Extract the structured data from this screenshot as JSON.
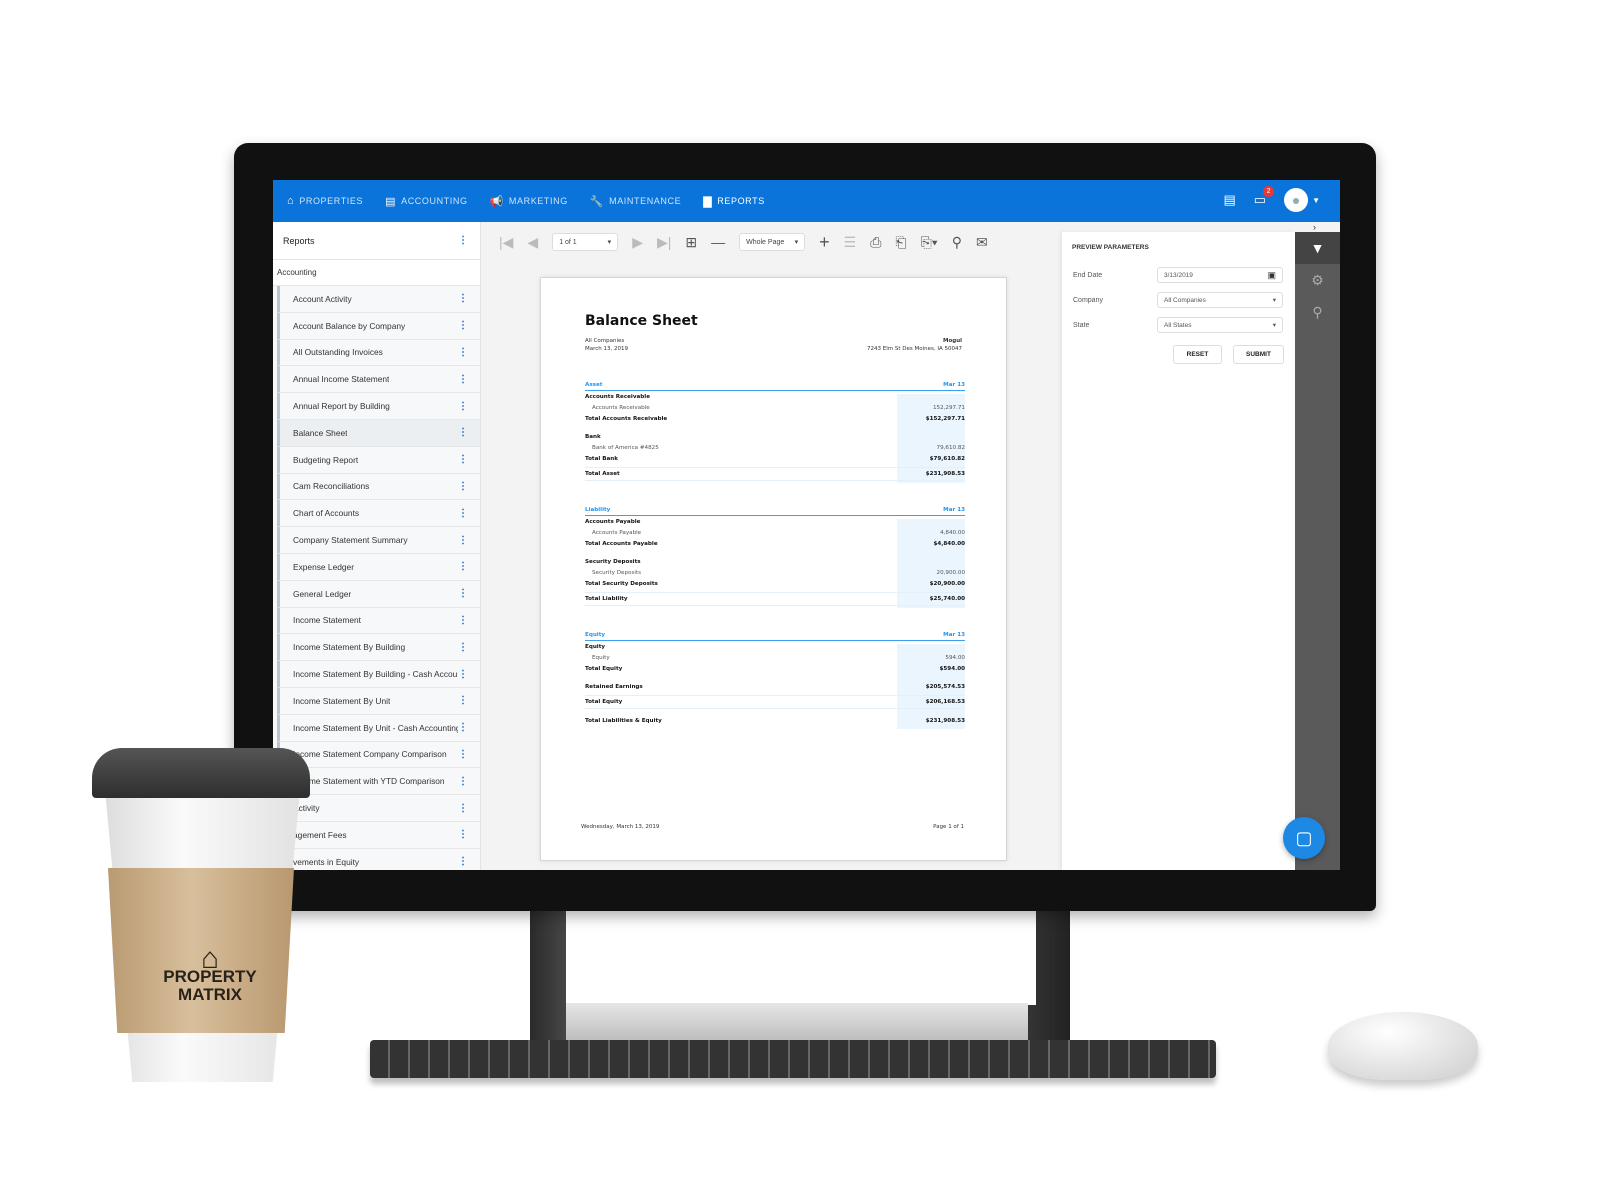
{
  "nav": {
    "items": [
      {
        "icon": "home-icon",
        "glyph": "⌂",
        "label": "PROPERTIES"
      },
      {
        "icon": "clipboard-icon",
        "glyph": "▤",
        "label": "ACCOUNTING"
      },
      {
        "icon": "megaphone-icon",
        "glyph": "📢",
        "label": "MARKETING"
      },
      {
        "icon": "wrench-icon",
        "glyph": "🔧",
        "label": "MAINTENANCE"
      },
      {
        "icon": "document-icon",
        "glyph": "▇",
        "label": "REPORTS"
      }
    ],
    "active": 4,
    "notification_count": "2"
  },
  "sidebar": {
    "title": "Reports",
    "section": "Accounting",
    "selected": 5,
    "items": [
      "Account Activity",
      "Account Balance by Company",
      "All Outstanding Invoices",
      "Annual Income Statement",
      "Annual Report by Building",
      "Balance Sheet",
      "Budgeting Report",
      "Cam Reconciliations",
      "Chart of Accounts",
      "Company Statement Summary",
      "Expense Ledger",
      "General Ledger",
      "Income Statement",
      "Income Statement By Building",
      "Income Statement By Building - Cash Accou...",
      "Income Statement By Unit",
      "Income Statement By Unit - Cash Accounting",
      "Income Statement Company Comparison",
      "Income Statement with YTD Comparison",
      "Activity",
      "agement Fees",
      "vements in Equity"
    ]
  },
  "toolbar": {
    "page_select": "1 of 1",
    "zoom_select": "Whole Page"
  },
  "report": {
    "title": "Balance Sheet",
    "company_filter": "All Companies",
    "date": "March 13, 2019",
    "company_name": "Mogul",
    "address": "7243 Elm St Des Moines, IA 50047",
    "footer_date": "Wednesday, March 13, 2019",
    "footer_page": "Page 1 of 1",
    "sections": [
      {
        "name": "Asset",
        "col": "Mar 13",
        "rows": [
          [
            "Accounts Receivable",
            "",
            "b"
          ],
          [
            "Accounts Receivable",
            "152,297.71",
            "i"
          ],
          [
            "Total Accounts Receivable",
            "$152,297.71",
            "b"
          ],
          [
            "Bank",
            "",
            "b gap"
          ],
          [
            "Bank of America #4825",
            "79,610.82",
            "i"
          ],
          [
            "Total Bank",
            "$79,610.82",
            "b"
          ],
          [
            "Total Asset",
            "$231,908.53",
            "b t"
          ]
        ]
      },
      {
        "name": "Liability",
        "col": "Mar 13",
        "rows": [
          [
            "Accounts Payable",
            "",
            "b"
          ],
          [
            "Accounts Payable",
            "4,840.00",
            "i"
          ],
          [
            "Total Accounts Payable",
            "$4,840.00",
            "b"
          ],
          [
            "Security Deposits",
            "",
            "b gap"
          ],
          [
            "Security Deposits",
            "20,900.00",
            "i"
          ],
          [
            "Total Security Deposits",
            "$20,900.00",
            "b"
          ],
          [
            "Total Liability",
            "$25,740.00",
            "b t"
          ]
        ]
      },
      {
        "name": "Equity",
        "col": "Mar 13",
        "rows": [
          [
            "Equity",
            "",
            "b"
          ],
          [
            "Equity",
            "594.00",
            "i"
          ],
          [
            "Total Equity",
            "$594.00",
            "b"
          ],
          [
            "Retained Earnings",
            "$205,574.53",
            "b gap"
          ],
          [
            "Total Equity",
            "$206,168.53",
            "b t"
          ],
          [
            "Total Liabilities & Equity",
            "$231,908.53",
            "b gap"
          ]
        ]
      }
    ]
  },
  "params": {
    "title": "PREVIEW PARAMETERS",
    "end_date_label": "End Date",
    "end_date": "3/13/2019",
    "company_label": "Company",
    "company": "All Companies",
    "state_label": "State",
    "state": "All States",
    "reset": "RESET",
    "submit": "SUBMIT"
  },
  "cup_logo": "PROPERTY MATRIX",
  "colors": {
    "nav": "#0a74da",
    "accent": "#2196f3"
  }
}
